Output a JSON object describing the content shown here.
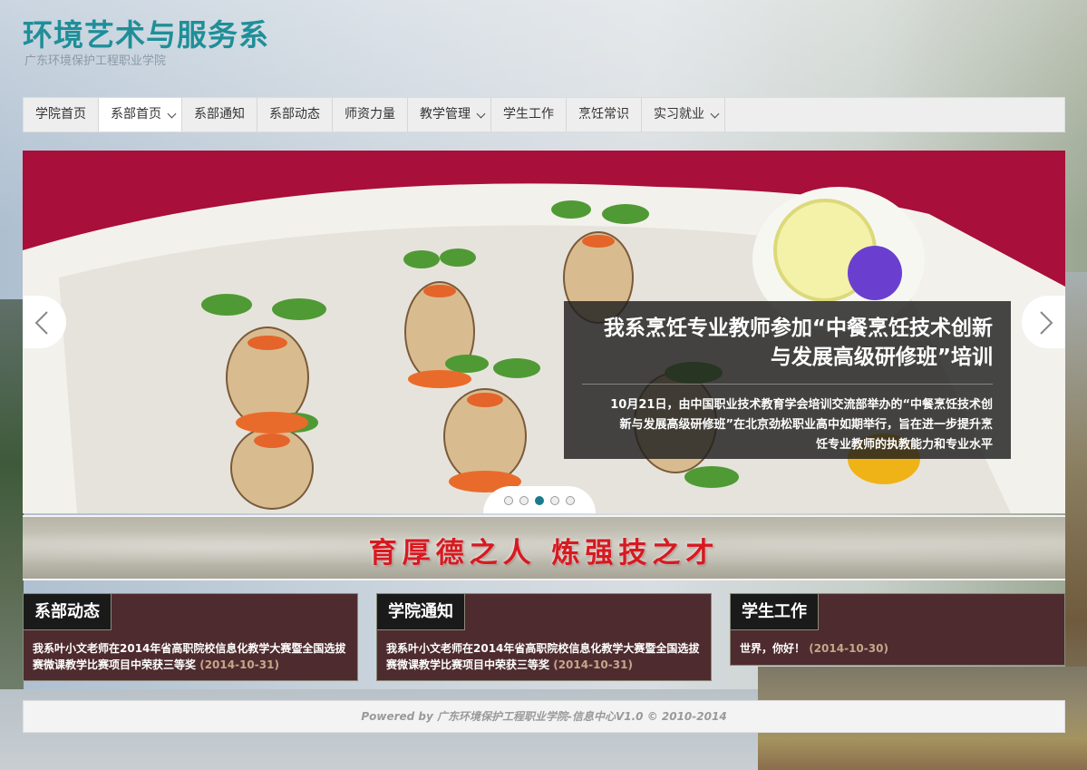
{
  "site": {
    "title": "环境艺术与服务系",
    "subtitle": "广东环境保护工程职业学院"
  },
  "nav": {
    "items": [
      {
        "label": "学院首页",
        "dropdown": false,
        "active": false
      },
      {
        "label": "系部首页",
        "dropdown": true,
        "active": true
      },
      {
        "label": "系部通知",
        "dropdown": false,
        "active": false
      },
      {
        "label": "系部动态",
        "dropdown": false,
        "active": false
      },
      {
        "label": "师资力量",
        "dropdown": false,
        "active": false
      },
      {
        "label": "教学管理",
        "dropdown": true,
        "active": false
      },
      {
        "label": "学生工作",
        "dropdown": false,
        "active": false
      },
      {
        "label": "烹饪常识",
        "dropdown": false,
        "active": false
      },
      {
        "label": "实习就业",
        "dropdown": true,
        "active": false
      }
    ]
  },
  "slider": {
    "caption_title_line1": "我系烹饪专业教师参加“中餐烹饪技术创新",
    "caption_title_line2": "与发展高级研修班”培训",
    "caption_text_line1": "10月21日，由中国职业技术教育学会培训交流部举办的“中餐烹饪技术创",
    "caption_text_line2": "新与发展高级研修班”在北京劲松职业高中如期举行，旨在进一步提升烹",
    "caption_text_line3": "饪专业教师的执教能力和专业水平",
    "total_slides": 5,
    "active_slide": 3,
    "prev_icon": "chevron-left-icon",
    "next_icon": "chevron-right-icon"
  },
  "banner": {
    "motto": "育厚德之人  炼强技之才"
  },
  "panels": {
    "dept_news": {
      "title": "系部动态",
      "item_text": "我系叶小文老师在2014年省高职院校信息化教学大赛暨全国选拔赛微课教学比赛项目中荣获三等奖",
      "item_date": "(2014-10-31)"
    },
    "college_notice": {
      "title": "学院通知",
      "item_text": "我系叶小文老师在2014年省高职院校信息化教学大赛暨全国选拔赛微课教学比赛项目中荣获三等奖",
      "item_date": "(2014-10-31)"
    },
    "student_work": {
      "title": "学生工作",
      "item_text": "世界，你好！",
      "item_date": "(2014-10-30)"
    }
  },
  "footer": {
    "text": "Powered by 广东环境保护工程职业学院-信息中心V1.0 © 2010-2014"
  },
  "colors": {
    "title": "#1e8f98",
    "panel_bg": "#4e2b2e",
    "date": "#c7a58a",
    "motto": "#d61a20",
    "active_dot": "#1b7b8c"
  }
}
